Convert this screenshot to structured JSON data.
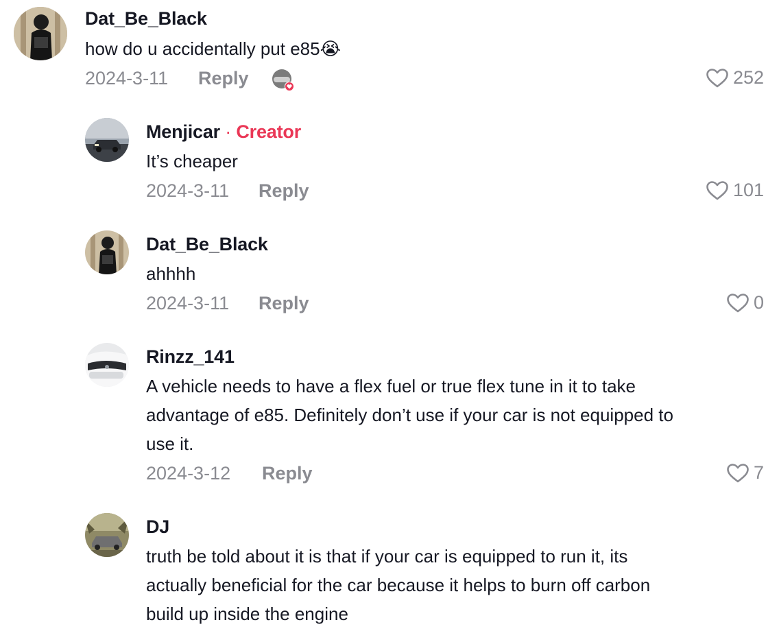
{
  "comments": [
    {
      "username": "Dat_Be_Black",
      "text": "how do u accidentally put e85😭",
      "date": "2024-3-11",
      "reply_label": "Reply",
      "likes": "252",
      "liked_by_creator": true
    },
    {
      "username": "Menjicar",
      "creator_label": "Creator",
      "creator_separator": "·",
      "text": "It’s cheaper",
      "date": "2024-3-11",
      "reply_label": "Reply",
      "likes": "101"
    },
    {
      "username": "Dat_Be_Black",
      "text": "ahhhh",
      "date": "2024-3-11",
      "reply_label": "Reply",
      "likes": "0"
    },
    {
      "username": "Rinzz_141",
      "text": "A vehicle needs to have a flex fuel or true flex tune in it to take\nadvantage of e85. Definitely don’t use if your car is not equipped to\nuse it.",
      "date": "2024-3-12",
      "reply_label": "Reply",
      "likes": "7"
    },
    {
      "username": "DJ",
      "text": "truth be told about it is that if your car is equipped to run it, its\nactually beneficial for the car because it helps to burn off carbon\nbuild up inside the engine"
    }
  ],
  "colors": {
    "primary_text": "#161823",
    "secondary_text": "#8a8b91",
    "creator_accent": "#ea3756"
  },
  "icons": {
    "like": "heart-outline-icon",
    "creator_liked_badge": "heart-badge-icon"
  }
}
